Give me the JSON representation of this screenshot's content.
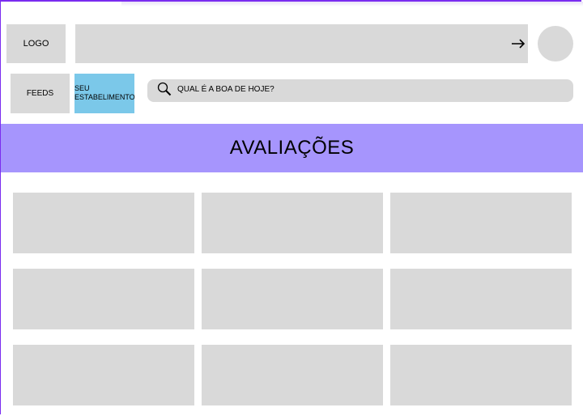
{
  "header": {
    "logo_label": "LOGO",
    "arrow_icon": "arrow-right-icon"
  },
  "nav": {
    "feeds_label": "FEEDS",
    "establishment_label": "SEU ESTABELIMENTO"
  },
  "search": {
    "placeholder": "QUAL É A BOA DE HOJE?",
    "icon": "search-icon"
  },
  "section": {
    "title": "AVALIAÇÕES"
  },
  "colors": {
    "frame": "#7a2cf0",
    "banner": "#a695fd",
    "establishment": "#7bc8e9",
    "placeholder_box": "#d9d9d9"
  },
  "reviews": {
    "rows": 3,
    "columns": 3
  }
}
